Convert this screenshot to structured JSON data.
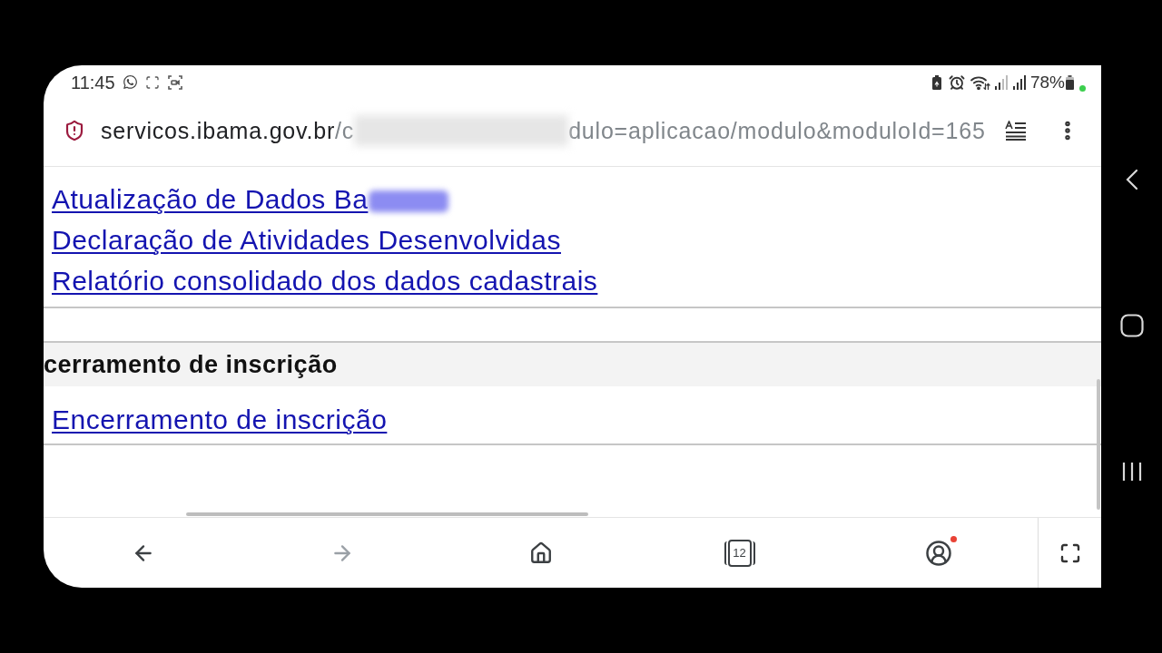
{
  "status_bar": {
    "time": "11:45",
    "battery": "78%"
  },
  "address_bar": {
    "host": "servicos.ibama.gov.br",
    "path_start": "/c",
    "path_redacted": true,
    "path_end": "dulo=aplicacao/modulo&moduloId=165"
  },
  "sections": [
    {
      "links": [
        {
          "label": "Atualização de Dados Ba",
          "redacted": true
        },
        {
          "label": "Declaração de Atividades Desenvolvidas",
          "redacted": false
        },
        {
          "label": "Relatório consolidado dos dados cadastrais",
          "redacted": false
        }
      ]
    },
    {
      "title": "cerramento de inscrição",
      "links": [
        {
          "label": "Encerramento de inscrição",
          "redacted": false
        }
      ]
    }
  ],
  "nav_buttons": [
    {
      "kind": "back",
      "disabled": false
    },
    {
      "kind": "forward",
      "disabled": true
    },
    {
      "kind": "home",
      "disabled": false
    },
    {
      "kind": "tabs",
      "count": "12",
      "disabled": false
    },
    {
      "kind": "account",
      "notification": true,
      "disabled": false
    }
  ]
}
